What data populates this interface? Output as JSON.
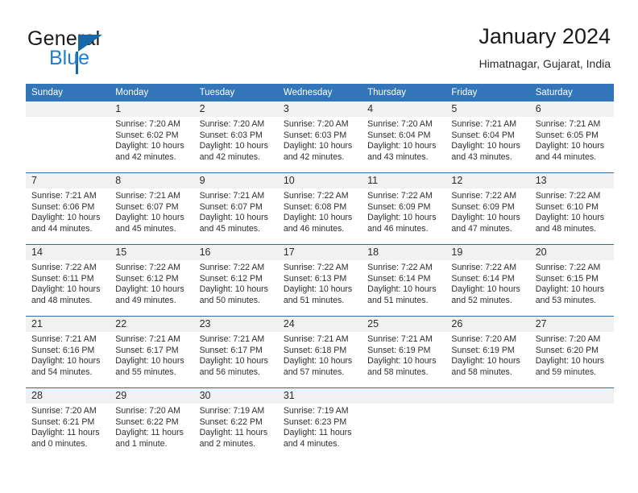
{
  "brand": {
    "name_part1": "General",
    "name_part2": "Blue",
    "accent_color": "#1c7fd4",
    "triangle_color": "#1768ab"
  },
  "header": {
    "title": "January 2024",
    "location": "Himatnagar, Gujarat, India"
  },
  "theme": {
    "header_row_bg": "#3275b8",
    "daynum_band_bg": "#f1f1f1",
    "separator_color": "#2f6da8",
    "text_color": "#2e2e2e"
  },
  "calendar": {
    "weekdays": [
      "Sunday",
      "Monday",
      "Tuesday",
      "Wednesday",
      "Thursday",
      "Friday",
      "Saturday"
    ],
    "weeks": [
      [
        {
          "day": "",
          "lines": []
        },
        {
          "day": "1",
          "lines": [
            "Sunrise: 7:20 AM",
            "Sunset: 6:02 PM",
            "Daylight: 10 hours",
            "and 42 minutes."
          ]
        },
        {
          "day": "2",
          "lines": [
            "Sunrise: 7:20 AM",
            "Sunset: 6:03 PM",
            "Daylight: 10 hours",
            "and 42 minutes."
          ]
        },
        {
          "day": "3",
          "lines": [
            "Sunrise: 7:20 AM",
            "Sunset: 6:03 PM",
            "Daylight: 10 hours",
            "and 42 minutes."
          ]
        },
        {
          "day": "4",
          "lines": [
            "Sunrise: 7:20 AM",
            "Sunset: 6:04 PM",
            "Daylight: 10 hours",
            "and 43 minutes."
          ]
        },
        {
          "day": "5",
          "lines": [
            "Sunrise: 7:21 AM",
            "Sunset: 6:04 PM",
            "Daylight: 10 hours",
            "and 43 minutes."
          ]
        },
        {
          "day": "6",
          "lines": [
            "Sunrise: 7:21 AM",
            "Sunset: 6:05 PM",
            "Daylight: 10 hours",
            "and 44 minutes."
          ]
        }
      ],
      [
        {
          "day": "7",
          "lines": [
            "Sunrise: 7:21 AM",
            "Sunset: 6:06 PM",
            "Daylight: 10 hours",
            "and 44 minutes."
          ]
        },
        {
          "day": "8",
          "lines": [
            "Sunrise: 7:21 AM",
            "Sunset: 6:07 PM",
            "Daylight: 10 hours",
            "and 45 minutes."
          ]
        },
        {
          "day": "9",
          "lines": [
            "Sunrise: 7:21 AM",
            "Sunset: 6:07 PM",
            "Daylight: 10 hours",
            "and 45 minutes."
          ]
        },
        {
          "day": "10",
          "lines": [
            "Sunrise: 7:22 AM",
            "Sunset: 6:08 PM",
            "Daylight: 10 hours",
            "and 46 minutes."
          ]
        },
        {
          "day": "11",
          "lines": [
            "Sunrise: 7:22 AM",
            "Sunset: 6:09 PM",
            "Daylight: 10 hours",
            "and 46 minutes."
          ]
        },
        {
          "day": "12",
          "lines": [
            "Sunrise: 7:22 AM",
            "Sunset: 6:09 PM",
            "Daylight: 10 hours",
            "and 47 minutes."
          ]
        },
        {
          "day": "13",
          "lines": [
            "Sunrise: 7:22 AM",
            "Sunset: 6:10 PM",
            "Daylight: 10 hours",
            "and 48 minutes."
          ]
        }
      ],
      [
        {
          "day": "14",
          "lines": [
            "Sunrise: 7:22 AM",
            "Sunset: 6:11 PM",
            "Daylight: 10 hours",
            "and 48 minutes."
          ]
        },
        {
          "day": "15",
          "lines": [
            "Sunrise: 7:22 AM",
            "Sunset: 6:12 PM",
            "Daylight: 10 hours",
            "and 49 minutes."
          ]
        },
        {
          "day": "16",
          "lines": [
            "Sunrise: 7:22 AM",
            "Sunset: 6:12 PM",
            "Daylight: 10 hours",
            "and 50 minutes."
          ]
        },
        {
          "day": "17",
          "lines": [
            "Sunrise: 7:22 AM",
            "Sunset: 6:13 PM",
            "Daylight: 10 hours",
            "and 51 minutes."
          ]
        },
        {
          "day": "18",
          "lines": [
            "Sunrise: 7:22 AM",
            "Sunset: 6:14 PM",
            "Daylight: 10 hours",
            "and 51 minutes."
          ]
        },
        {
          "day": "19",
          "lines": [
            "Sunrise: 7:22 AM",
            "Sunset: 6:14 PM",
            "Daylight: 10 hours",
            "and 52 minutes."
          ]
        },
        {
          "day": "20",
          "lines": [
            "Sunrise: 7:22 AM",
            "Sunset: 6:15 PM",
            "Daylight: 10 hours",
            "and 53 minutes."
          ]
        }
      ],
      [
        {
          "day": "21",
          "lines": [
            "Sunrise: 7:21 AM",
            "Sunset: 6:16 PM",
            "Daylight: 10 hours",
            "and 54 minutes."
          ]
        },
        {
          "day": "22",
          "lines": [
            "Sunrise: 7:21 AM",
            "Sunset: 6:17 PM",
            "Daylight: 10 hours",
            "and 55 minutes."
          ]
        },
        {
          "day": "23",
          "lines": [
            "Sunrise: 7:21 AM",
            "Sunset: 6:17 PM",
            "Daylight: 10 hours",
            "and 56 minutes."
          ]
        },
        {
          "day": "24",
          "lines": [
            "Sunrise: 7:21 AM",
            "Sunset: 6:18 PM",
            "Daylight: 10 hours",
            "and 57 minutes."
          ]
        },
        {
          "day": "25",
          "lines": [
            "Sunrise: 7:21 AM",
            "Sunset: 6:19 PM",
            "Daylight: 10 hours",
            "and 58 minutes."
          ]
        },
        {
          "day": "26",
          "lines": [
            "Sunrise: 7:20 AM",
            "Sunset: 6:19 PM",
            "Daylight: 10 hours",
            "and 58 minutes."
          ]
        },
        {
          "day": "27",
          "lines": [
            "Sunrise: 7:20 AM",
            "Sunset: 6:20 PM",
            "Daylight: 10 hours",
            "and 59 minutes."
          ]
        }
      ],
      [
        {
          "day": "28",
          "lines": [
            "Sunrise: 7:20 AM",
            "Sunset: 6:21 PM",
            "Daylight: 11 hours",
            "and 0 minutes."
          ]
        },
        {
          "day": "29",
          "lines": [
            "Sunrise: 7:20 AM",
            "Sunset: 6:22 PM",
            "Daylight: 11 hours",
            "and 1 minute."
          ]
        },
        {
          "day": "30",
          "lines": [
            "Sunrise: 7:19 AM",
            "Sunset: 6:22 PM",
            "Daylight: 11 hours",
            "and 2 minutes."
          ]
        },
        {
          "day": "31",
          "lines": [
            "Sunrise: 7:19 AM",
            "Sunset: 6:23 PM",
            "Daylight: 11 hours",
            "and 4 minutes."
          ]
        },
        {
          "day": "",
          "lines": []
        },
        {
          "day": "",
          "lines": []
        },
        {
          "day": "",
          "lines": []
        }
      ]
    ]
  }
}
